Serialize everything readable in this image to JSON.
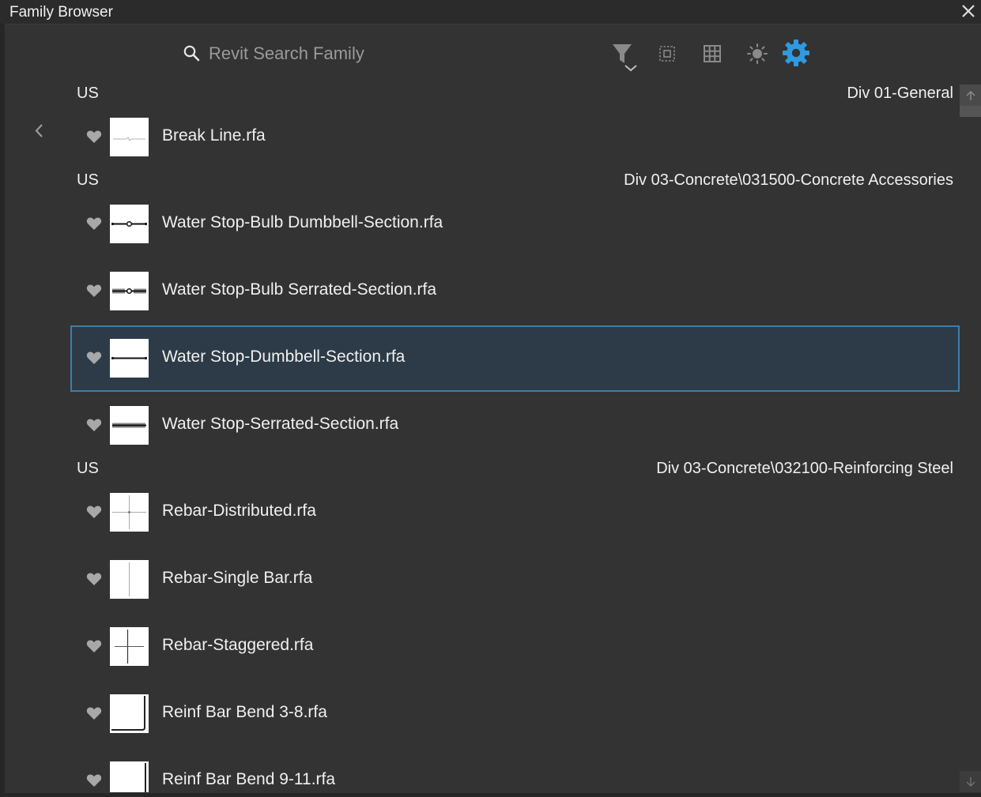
{
  "window": {
    "title": "Family Browser"
  },
  "toolbar": {
    "search_placeholder": "Revit Search Family",
    "icons": [
      "search-icon",
      "filter-icon",
      "select-all-icon",
      "grid-view-icon",
      "theme-toggle-icon",
      "settings-icon"
    ],
    "accent_color": "#2f9ae0"
  },
  "groups": [
    {
      "library": "US",
      "path": "Div 01-General",
      "items": [
        {
          "name": "Break Line.rfa",
          "selected": false
        }
      ]
    },
    {
      "library": "US",
      "path": "Div 03-Concrete\\031500-Concrete Accessories",
      "items": [
        {
          "name": "Water Stop-Bulb Dumbbell-Section.rfa",
          "selected": false
        },
        {
          "name": "Water Stop-Bulb Serrated-Section.rfa",
          "selected": false
        },
        {
          "name": "Water Stop-Dumbbell-Section.rfa",
          "selected": true
        },
        {
          "name": "Water Stop-Serrated-Section.rfa",
          "selected": false
        }
      ]
    },
    {
      "library": "US",
      "path": "Div 03-Concrete\\032100-Reinforcing Steel",
      "items": [
        {
          "name": "Rebar-Distributed.rfa",
          "selected": false
        },
        {
          "name": "Rebar-Single Bar.rfa",
          "selected": false
        },
        {
          "name": "Rebar-Staggered.rfa",
          "selected": false
        },
        {
          "name": "Reinf Bar Bend 3-8.rfa",
          "selected": false
        },
        {
          "name": "Reinf Bar Bend 9-11.rfa",
          "selected": false
        }
      ]
    }
  ],
  "colors": {
    "background": "#333333",
    "selected_background": "#2c3b47",
    "selected_border": "#3e7ea8"
  }
}
